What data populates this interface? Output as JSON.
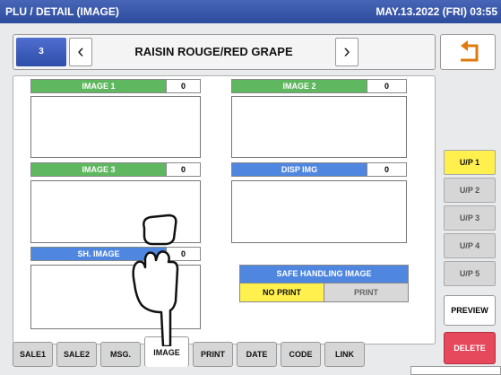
{
  "title": "PLU / DETAIL (IMAGE)",
  "datetime": "MAY.13.2022 (FRI) 03:55",
  "plu": {
    "number": "3",
    "name": "RAISIN ROUGE/RED GRAPE"
  },
  "fields": {
    "image1": {
      "label": "IMAGE 1",
      "value": "0"
    },
    "image2": {
      "label": "IMAGE 2",
      "value": "0"
    },
    "image3": {
      "label": "IMAGE 3",
      "value": "0"
    },
    "disp_img": {
      "label": "DISP IMG",
      "value": "0"
    },
    "sh_image": {
      "label": "SH. IMAGE",
      "value": "0"
    }
  },
  "safe_handling": {
    "title": "SAFE HANDLING IMAGE",
    "options": [
      "NO PRINT",
      "PRINT"
    ],
    "selected": "NO PRINT"
  },
  "tabs": [
    "SALE1",
    "SALE2",
    "MSG.",
    "IMAGE",
    "PRINT",
    "DATE",
    "CODE",
    "LINK"
  ],
  "active_tab": "IMAGE",
  "pages": [
    "U/P 1",
    "U/P 2",
    "U/P 3",
    "U/P 4",
    "U/P 5"
  ],
  "active_page": "U/P 1",
  "actions": {
    "preview": "PREVIEW",
    "delete": "DELETE"
  },
  "icons": {
    "back": "return-arrow-icon",
    "pointer": "pointing-hand-icon"
  },
  "colors": {
    "title_bar": "#3a58aa",
    "green_label": "#5fb85f",
    "blue_label": "#4f87e0",
    "selected": "#fff04e",
    "delete": "#e6485c"
  }
}
